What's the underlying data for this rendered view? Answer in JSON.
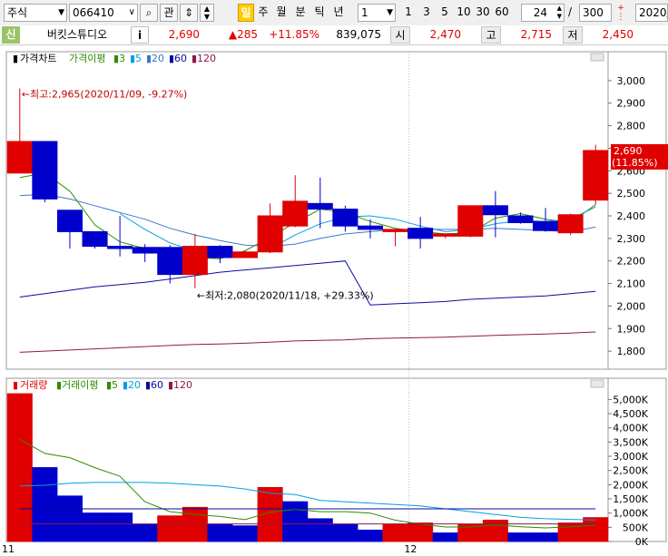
{
  "toolbar": {
    "market": "주식",
    "code": "066410",
    "btn_search": "⌕",
    "btn_gwan": "관",
    "period_selected": "일",
    "periods": [
      "주",
      "월",
      "분",
      "틱",
      "년"
    ],
    "interval": "1",
    "numbers": [
      "1",
      "3",
      "5",
      "10",
      "30",
      "60"
    ],
    "count_shown": "24",
    "count_total": "300",
    "date_fragment": "2020/"
  },
  "info": {
    "tag": "신",
    "name": "버킷스튜디오",
    "price": "2,690",
    "change": "▲285",
    "change_pct": "+11.85%",
    "volume": "839,075",
    "open_label": "시",
    "open": "2,470",
    "high_label": "고",
    "high": "2,715",
    "low_label": "저",
    "low": "2,450"
  },
  "colors": {
    "up": "#e00000",
    "down": "#0000cc",
    "ma3": "#2e8b00",
    "ma5": "#00a0e0",
    "ma20": "#3c78c8",
    "ma60": "#0a0aa0",
    "ma120": "#8b1a4a"
  },
  "chart_data": [
    {
      "type": "candlestick",
      "title": "가격차트",
      "legend": [
        {
          "label": "가격이평",
          "color": "#2e8b00"
        },
        {
          "label": "3",
          "color": "#2e8b00"
        },
        {
          "label": "5",
          "color": "#00a0e0"
        },
        {
          "label": "20",
          "color": "#3c78c8"
        },
        {
          "label": "60",
          "color": "#0a0aa0"
        },
        {
          "label": "120",
          "color": "#8b1a4a"
        }
      ],
      "x_labels": [
        {
          "index": 0,
          "label": "11"
        },
        {
          "index": 16,
          "label": "12"
        }
      ],
      "ylim": [
        1720,
        3080
      ],
      "yticks": [
        1800,
        1900,
        2000,
        2100,
        2200,
        2300,
        2400,
        2500,
        2600,
        2700,
        2800,
        2900,
        3000
      ],
      "ytick_labels": [
        "1,800",
        "1,900",
        "2,000",
        "2,100",
        "2,200",
        "2,300",
        "2,400",
        "2,500",
        "2,600",
        "2,700",
        "2,800",
        "2,900",
        "3,000"
      ],
      "candles": [
        {
          "o": 2590,
          "h": 2965,
          "l": 2590,
          "c": 2730
        },
        {
          "o": 2730,
          "h": 2730,
          "l": 2460,
          "c": 2475
        },
        {
          "o": 2425,
          "h": 2425,
          "l": 2255,
          "c": 2330
        },
        {
          "o": 2330,
          "h": 2330,
          "l": 2255,
          "c": 2265
        },
        {
          "o": 2265,
          "h": 2400,
          "l": 2220,
          "c": 2255
        },
        {
          "o": 2260,
          "h": 2275,
          "l": 2195,
          "c": 2235
        },
        {
          "o": 2260,
          "h": 2270,
          "l": 2100,
          "c": 2140
        },
        {
          "o": 2140,
          "h": 2320,
          "l": 2080,
          "c": 2265
        },
        {
          "o": 2265,
          "h": 2270,
          "l": 2190,
          "c": 2215
        },
        {
          "o": 2215,
          "h": 2245,
          "l": 2215,
          "c": 2240
        },
        {
          "o": 2240,
          "h": 2455,
          "l": 2235,
          "c": 2400
        },
        {
          "o": 2355,
          "h": 2580,
          "l": 2350,
          "c": 2465
        },
        {
          "o": 2455,
          "h": 2570,
          "l": 2345,
          "c": 2430
        },
        {
          "o": 2430,
          "h": 2445,
          "l": 2330,
          "c": 2355
        },
        {
          "o": 2355,
          "h": 2385,
          "l": 2300,
          "c": 2340
        },
        {
          "o": 2330,
          "h": 2340,
          "l": 2265,
          "c": 2340
        },
        {
          "o": 2345,
          "h": 2395,
          "l": 2255,
          "c": 2300
        },
        {
          "o": 2310,
          "h": 2320,
          "l": 2300,
          "c": 2320
        },
        {
          "o": 2310,
          "h": 2440,
          "l": 2305,
          "c": 2445
        },
        {
          "o": 2445,
          "h": 2510,
          "l": 2305,
          "c": 2405
        },
        {
          "o": 2400,
          "h": 2415,
          "l": 2365,
          "c": 2370
        },
        {
          "o": 2375,
          "h": 2435,
          "l": 2330,
          "c": 2335
        },
        {
          "o": 2325,
          "h": 2410,
          "l": 2315,
          "c": 2405
        },
        {
          "o": 2470,
          "h": 2715,
          "l": 2450,
          "c": 2690
        }
      ],
      "ma": [
        {
          "name": "3",
          "color": "#2e8b00",
          "values": [
            2570,
            2590,
            2510,
            2360,
            2285,
            2255,
            2215,
            2215,
            2210,
            2245,
            2305,
            2370,
            2430,
            2415,
            2375,
            2345,
            2330,
            2320,
            2325,
            2390,
            2410,
            2385,
            2370,
            2450
          ]
        },
        {
          "name": "5",
          "color": "#00a0e0",
          "values": [
            null,
            null,
            null,
            null,
            2410,
            2340,
            2280,
            2245,
            2225,
            2225,
            2255,
            2315,
            2365,
            2395,
            2400,
            2385,
            2355,
            2330,
            2340,
            2365,
            2380,
            2375,
            2385,
            2440
          ]
        },
        {
          "name": "20",
          "color": "#3c78c8",
          "values": [
            2490,
            2495,
            2475,
            2445,
            2415,
            2385,
            2345,
            2315,
            2290,
            2270,
            2265,
            2275,
            2300,
            2320,
            2330,
            2340,
            2340,
            2340,
            2340,
            2345,
            2340,
            2335,
            2330,
            2350
          ]
        },
        {
          "name": "60",
          "color": "#0a0aa0",
          "values": [
            2040,
            2055,
            2070,
            2085,
            2095,
            2105,
            2120,
            2135,
            2150,
            2160,
            2170,
            2180,
            2190,
            2200,
            2005,
            2010,
            2015,
            2020,
            2030,
            2035,
            2040,
            2045,
            2055,
            2065
          ]
        },
        {
          "name": "120",
          "color": "#8b1a4a",
          "values": [
            1795,
            1800,
            1805,
            1810,
            1815,
            1820,
            1825,
            1830,
            1832,
            1835,
            1840,
            1845,
            1848,
            1850,
            1855,
            1858,
            1860,
            1862,
            1866,
            1870,
            1873,
            1876,
            1880,
            1885
          ]
        }
      ],
      "annotations": {
        "high": "←최고:2,965(2020/11/09, -9.27%)",
        "low": "←최저:2,080(2020/11/18, +29.33%)",
        "last_price": "2,690",
        "last_pct": "(11.85%)"
      }
    },
    {
      "type": "bar",
      "title": "거래량",
      "legend": [
        {
          "label": "거래이평",
          "color": "#2e8b00"
        },
        {
          "label": "5",
          "color": "#2e8b00"
        },
        {
          "label": "20",
          "color": "#00a0e0"
        },
        {
          "label": "60",
          "color": "#0a0aa0"
        },
        {
          "label": "120",
          "color": "#8b1a4a"
        }
      ],
      "ylim": [
        0,
        5300000
      ],
      "yticks": [
        0,
        500000,
        1000000,
        1500000,
        2000000,
        2500000,
        3000000,
        3500000,
        4000000,
        4500000,
        5000000
      ],
      "ytick_labels": [
        "0K",
        "500K",
        "1,000K",
        "1,500K",
        "2,000K",
        "2,500K",
        "3,000K",
        "3,500K",
        "4,000K",
        "4,500K",
        "5,000K"
      ],
      "values": [
        5200000,
        2600000,
        1600000,
        1000000,
        1000000,
        600000,
        900000,
        1200000,
        600000,
        550000,
        1900000,
        1400000,
        800000,
        600000,
        400000,
        600000,
        650000,
        300000,
        600000,
        750000,
        300000,
        300000,
        650000,
        839075
      ],
      "up": [
        true,
        false,
        false,
        false,
        false,
        false,
        true,
        true,
        false,
        false,
        true,
        false,
        false,
        false,
        false,
        true,
        true,
        false,
        true,
        true,
        false,
        false,
        true,
        true
      ],
      "ma": [
        {
          "name": "5",
          "color": "#2e8b00",
          "values": [
            3600,
            3100,
            2950,
            2600,
            2300,
            1400,
            1050,
            950,
            880,
            770,
            1030,
            1130,
            1050,
            1050,
            1000,
            750,
            610,
            510,
            510,
            580,
            520,
            480,
            520,
            570
          ]
        },
        {
          "name": "20",
          "color": "#00a0e0",
          "values": [
            1950,
            1980,
            2050,
            2080,
            2080,
            2080,
            2050,
            2000,
            1950,
            1850,
            1700,
            1650,
            1450,
            1400,
            1350,
            1300,
            1250,
            1150,
            1050,
            950,
            850,
            800,
            780,
            760
          ]
        },
        {
          "name": "60",
          "color": "#0a0aa0",
          "values": [
            1150,
            1150,
            1150,
            1150,
            1150,
            1150,
            1150,
            1150,
            1150,
            1150,
            1150,
            1150,
            1150,
            1150,
            1150,
            1150,
            1150,
            1150,
            1150,
            1150,
            1150,
            1150,
            1150,
            1150
          ]
        },
        {
          "name": "120",
          "color": "#8b1a4a",
          "values": [
            620,
            620,
            620,
            620,
            620,
            620,
            620,
            620,
            620,
            620,
            620,
            620,
            620,
            620,
            620,
            620,
            620,
            620,
            620,
            620,
            620,
            620,
            620,
            620
          ]
        }
      ]
    }
  ]
}
